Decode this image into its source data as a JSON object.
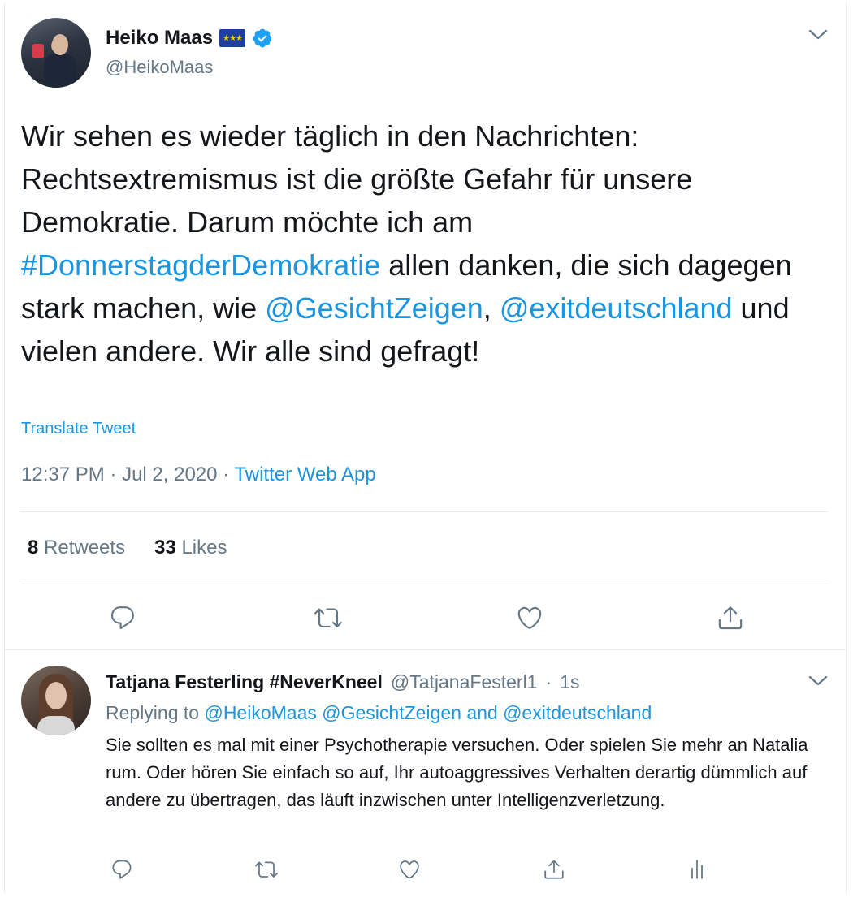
{
  "colors": {
    "link": "#1b95e0",
    "muted": "#657786",
    "text": "#14171a",
    "divider": "#e6ecf0"
  },
  "tweet": {
    "author_name": "Heiko Maas",
    "author_handle": "@HeikoMaas",
    "flag_icon": "eu-flag-icon",
    "verified_icon": "verified-badge-icon",
    "text_parts": {
      "p1": "Wir sehen es wieder täglich in den Nachrichten: Rechtsextremismus ist die größte Gefahr für unsere Demokratie. Darum möchte ich am ",
      "hashtag": "#DonnerstagderDemokratie",
      "p2": " allen danken, die sich dagegen stark machen, wie ",
      "mention1": "@GesichtZeigen",
      "p3": ", ",
      "mention2": "@exitdeutschland",
      "p4": " und vielen andere. Wir alle sind gefragt!"
    },
    "translate_label": "Translate Tweet",
    "time": "12:37 PM",
    "separator": "·",
    "date": "Jul 2, 2020",
    "source": "Twitter Web App",
    "retweets_count": "8",
    "retweets_label": "Retweets",
    "likes_count": "33",
    "likes_label": "Likes",
    "actions": [
      "reply-icon",
      "retweet-icon",
      "like-icon",
      "share-icon"
    ]
  },
  "reply": {
    "author_name": "Tatjana Festerling #NeverKneel",
    "author_handle": "@TatjanaFesterl1",
    "separator": "·",
    "age": "1s",
    "replying_prefix": "Replying to",
    "replying_to_1": "@HeikoMaas",
    "replying_to_2": "@GesichtZeigen",
    "replying_and": "and",
    "replying_to_3": "@exitdeutschland",
    "text": "Sie sollten es mal mit einer Psychotherapie versuchen. Oder spielen Sie mehr an Natalia rum. Oder hören Sie einfach so auf, Ihr autoaggressives Verhalten derartig dümmlich auf andere zu übertragen, das läuft inzwischen unter Intelligenzverletzung.",
    "actions": [
      "reply-icon",
      "retweet-icon",
      "like-icon",
      "share-icon",
      "analytics-icon"
    ]
  }
}
